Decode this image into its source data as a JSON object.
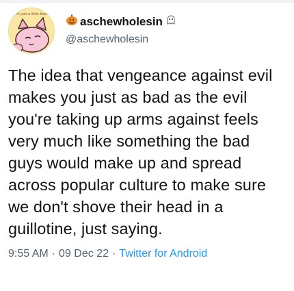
{
  "tweet": {
    "display_name": "aschewholesin",
    "handle": "@aschewholesin",
    "text": "The idea that vengeance against evil makes you just as bad as the evil you're taking up arms against feels very much like something the bad guys would make up and spread across popular culture to make sure we don't shove their head in a guillotine, just saying.",
    "time": "9:55 AM",
    "date": "09 Dec 22",
    "separator": "·",
    "source": "Twitter for Android"
  },
  "avatar": {
    "caption": "I'm just a little freak"
  },
  "icons": {
    "pumpkin": "pumpkin-emoji-icon",
    "ghost": "ghost-emoji-icon"
  },
  "colors": {
    "text": "#0f1419",
    "secondary": "#536471",
    "link": "#1d9bf0",
    "avatar_bg": "#fbe7a3"
  }
}
